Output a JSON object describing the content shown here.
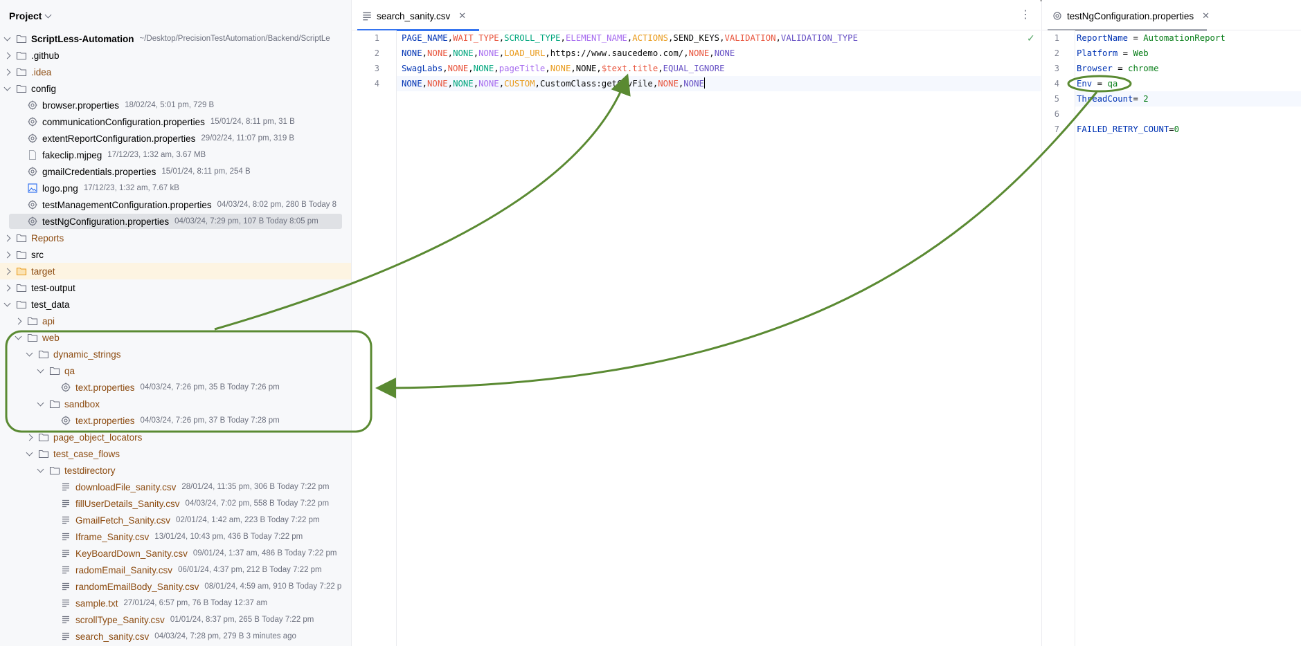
{
  "project": {
    "title": "Project",
    "tree": [
      {
        "name": "ScriptLess-Automation",
        "meta": "~/Desktop/PrecisionTestAutomation/Backend/ScriptLe",
        "depth": 0,
        "chev": "open",
        "icon": "folder",
        "bold": true
      },
      {
        "name": ".github",
        "meta": "",
        "depth": 0,
        "chev": "closed",
        "icon": "folder"
      },
      {
        "name": ".idea",
        "meta": "",
        "depth": 0,
        "chev": "closed",
        "icon": "folder",
        "brown": true
      },
      {
        "name": "config",
        "meta": "",
        "depth": 0,
        "chev": "open",
        "icon": "folder"
      },
      {
        "name": "browser.properties",
        "meta": "18/02/24, 5:01 pm, 729 B",
        "depth": 1,
        "chev": "none",
        "icon": "gear"
      },
      {
        "name": "communicationConfiguration.properties",
        "meta": "15/01/24, 8:11 pm, 31 B",
        "depth": 1,
        "chev": "none",
        "icon": "gear"
      },
      {
        "name": "extentReportConfiguration.properties",
        "meta": "29/02/24, 11:07 pm, 319 B",
        "depth": 1,
        "chev": "none",
        "icon": "gear"
      },
      {
        "name": "fakeclip.mjpeg",
        "meta": "17/12/23, 1:32 am, 3.67 MB",
        "depth": 1,
        "chev": "none",
        "icon": "file"
      },
      {
        "name": "gmailCredentials.properties",
        "meta": "15/01/24, 8:11 pm, 254 B",
        "depth": 1,
        "chev": "none",
        "icon": "gear"
      },
      {
        "name": "logo.png",
        "meta": "17/12/23, 1:32 am, 7.67 kB",
        "depth": 1,
        "chev": "none",
        "icon": "image"
      },
      {
        "name": "testManagementConfiguration.properties",
        "meta": "04/03/24, 8:02 pm, 280 B Today 8",
        "depth": 1,
        "chev": "none",
        "icon": "gear"
      },
      {
        "name": "testNgConfiguration.properties",
        "meta": "04/03/24, 7:29 pm, 107 B Today 8:05 pm",
        "depth": 1,
        "chev": "none",
        "icon": "gear",
        "selected": true
      },
      {
        "name": "Reports",
        "meta": "",
        "depth": 0,
        "chev": "closed",
        "icon": "folder",
        "brown": true
      },
      {
        "name": "src",
        "meta": "",
        "depth": 0,
        "chev": "closed",
        "icon": "folder"
      },
      {
        "name": "target",
        "meta": "",
        "depth": 0,
        "chev": "closed",
        "icon": "folder-orange",
        "brown": true,
        "highlight": true
      },
      {
        "name": "test-output",
        "meta": "",
        "depth": 0,
        "chev": "closed",
        "icon": "folder"
      },
      {
        "name": "test_data",
        "meta": "",
        "depth": 0,
        "chev": "open",
        "icon": "folder"
      },
      {
        "name": "api",
        "meta": "",
        "depth": 1,
        "chev": "closed",
        "icon": "folder",
        "brown": true
      },
      {
        "name": "web",
        "meta": "",
        "depth": 1,
        "chev": "open",
        "icon": "folder",
        "brown": true
      },
      {
        "name": "dynamic_strings",
        "meta": "",
        "depth": 2,
        "chev": "open",
        "icon": "folder",
        "brown": true
      },
      {
        "name": "qa",
        "meta": "",
        "depth": 3,
        "chev": "open",
        "icon": "folder",
        "brown": true
      },
      {
        "name": "text.properties",
        "meta": "04/03/24, 7:26 pm, 35 B Today 7:26 pm",
        "depth": 4,
        "chev": "none",
        "icon": "gear",
        "brown": true
      },
      {
        "name": "sandbox",
        "meta": "",
        "depth": 3,
        "chev": "open",
        "icon": "folder",
        "brown": true
      },
      {
        "name": "text.properties",
        "meta": "04/03/24, 7:26 pm, 37 B Today 7:28 pm",
        "depth": 4,
        "chev": "none",
        "icon": "gear",
        "brown": true
      },
      {
        "name": "page_object_locators",
        "meta": "",
        "depth": 2,
        "chev": "closed",
        "icon": "folder",
        "brown": true
      },
      {
        "name": "test_case_flows",
        "meta": "",
        "depth": 2,
        "chev": "open",
        "icon": "folder",
        "brown": true
      },
      {
        "name": "testdirectory",
        "meta": "",
        "depth": 3,
        "chev": "open",
        "icon": "folder",
        "brown": true
      },
      {
        "name": "downloadFile_sanity.csv",
        "meta": "28/01/24, 11:35 pm, 306 B Today 7:22 pm",
        "depth": 4,
        "chev": "none",
        "icon": "text",
        "brown": true
      },
      {
        "name": "fillUserDetails_Sanity.csv",
        "meta": "04/03/24, 7:02 pm, 558 B Today 7:22 pm",
        "depth": 4,
        "chev": "none",
        "icon": "text",
        "brown": true
      },
      {
        "name": "GmailFetch_Sanity.csv",
        "meta": "02/01/24, 1:42 am, 223 B Today 7:22 pm",
        "depth": 4,
        "chev": "none",
        "icon": "text",
        "brown": true
      },
      {
        "name": "Iframe_Sanity.csv",
        "meta": "13/01/24, 10:43 pm, 436 B Today 7:22 pm",
        "depth": 4,
        "chev": "none",
        "icon": "text",
        "brown": true
      },
      {
        "name": "KeyBoardDown_Sanity.csv",
        "meta": "09/01/24, 1:37 am, 486 B Today 7:22 pm",
        "depth": 4,
        "chev": "none",
        "icon": "text",
        "brown": true
      },
      {
        "name": "radomEmail_Sanity.csv",
        "meta": "06/01/24, 4:37 pm, 212 B Today 7:22 pm",
        "depth": 4,
        "chev": "none",
        "icon": "text",
        "brown": true
      },
      {
        "name": "randomEmailBody_Sanity.csv",
        "meta": "08/01/24, 4:59 am, 910 B Today 7:22 p",
        "depth": 4,
        "chev": "none",
        "icon": "text",
        "brown": true
      },
      {
        "name": "sample.txt",
        "meta": "27/01/24, 6:57 pm, 76 B Today 12:37 am",
        "depth": 4,
        "chev": "none",
        "icon": "text",
        "brown": true
      },
      {
        "name": "scrollType_Sanity.csv",
        "meta": "01/01/24, 8:37 pm, 265 B Today 7:22 pm",
        "depth": 4,
        "chev": "none",
        "icon": "text",
        "brown": true
      },
      {
        "name": "search_sanity.csv",
        "meta": "04/03/24, 7:28 pm, 279 B 3 minutes ago",
        "depth": 4,
        "chev": "none",
        "icon": "text",
        "brown": true
      }
    ]
  },
  "editor_left": {
    "tab_label": "search_sanity.csv",
    "close_glyph": "✕",
    "more_glyph": "⋮",
    "check_glyph": "✓",
    "line_numbers": [
      "1",
      "2",
      "3",
      "4"
    ],
    "lines": [
      [
        {
          "t": "PAGE_NAME",
          "c": "#0033b3"
        },
        {
          "t": ",",
          "c": "#000000"
        },
        {
          "t": "WAIT_TYPE",
          "c": "#e8533b"
        },
        {
          "t": ",",
          "c": "#000000"
        },
        {
          "t": "SCROLL_TYPE",
          "c": "#00a67d"
        },
        {
          "t": ",",
          "c": "#000000"
        },
        {
          "t": "ELEMENT_NAME",
          "c": "#a66bef"
        },
        {
          "t": ",",
          "c": "#000000"
        },
        {
          "t": "ACTIONS",
          "c": "#e99a1a"
        },
        {
          "t": ",",
          "c": "#000000"
        },
        {
          "t": "SEND_KEYS",
          "c": "#0d0d0d"
        },
        {
          "t": ",",
          "c": "#000000"
        },
        {
          "t": "VALIDATION",
          "c": "#e8533b"
        },
        {
          "t": ",",
          "c": "#000000"
        },
        {
          "t": "VALIDATION_TYPE",
          "c": "#6650c4"
        }
      ],
      [
        {
          "t": "NONE",
          "c": "#0033b3"
        },
        {
          "t": ",",
          "c": "#000000"
        },
        {
          "t": "NONE",
          "c": "#e8533b"
        },
        {
          "t": ",",
          "c": "#000000"
        },
        {
          "t": "NONE",
          "c": "#00a67d"
        },
        {
          "t": ",",
          "c": "#000000"
        },
        {
          "t": "NONE",
          "c": "#a66bef"
        },
        {
          "t": ",",
          "c": "#000000"
        },
        {
          "t": "LOAD_URL",
          "c": "#e99a1a"
        },
        {
          "t": ",",
          "c": "#000000"
        },
        {
          "t": "https://www.saucedemo.com/",
          "c": "#0d0d0d"
        },
        {
          "t": ",",
          "c": "#000000"
        },
        {
          "t": "NONE",
          "c": "#e8533b"
        },
        {
          "t": ",",
          "c": "#000000"
        },
        {
          "t": "NONE",
          "c": "#6650c4"
        }
      ],
      [
        {
          "t": "SwagLabs",
          "c": "#0033b3"
        },
        {
          "t": ",",
          "c": "#000000"
        },
        {
          "t": "NONE",
          "c": "#e8533b"
        },
        {
          "t": ",",
          "c": "#000000"
        },
        {
          "t": "NONE",
          "c": "#00a67d"
        },
        {
          "t": ",",
          "c": "#000000"
        },
        {
          "t": "pageTitle",
          "c": "#a66bef"
        },
        {
          "t": ",",
          "c": "#000000"
        },
        {
          "t": "NONE",
          "c": "#e99a1a"
        },
        {
          "t": ",",
          "c": "#000000"
        },
        {
          "t": "NONE",
          "c": "#0d0d0d"
        },
        {
          "t": ",",
          "c": "#000000"
        },
        {
          "t": "$text.title",
          "c": "#e8533b"
        },
        {
          "t": ",",
          "c": "#000000"
        },
        {
          "t": "EQUAL_IGNORE",
          "c": "#6650c4"
        }
      ],
      [
        {
          "t": "NONE",
          "c": "#0033b3"
        },
        {
          "t": ",",
          "c": "#000000"
        },
        {
          "t": "NONE",
          "c": "#e8533b"
        },
        {
          "t": ",",
          "c": "#000000"
        },
        {
          "t": "NONE",
          "c": "#00a67d"
        },
        {
          "t": ",",
          "c": "#000000"
        },
        {
          "t": "NONE",
          "c": "#a66bef"
        },
        {
          "t": ",",
          "c": "#000000"
        },
        {
          "t": "CUSTOM",
          "c": "#e99a1a"
        },
        {
          "t": ",",
          "c": "#000000"
        },
        {
          "t": "CustomClass:getCsvFile",
          "c": "#0d0d0d"
        },
        {
          "t": ",",
          "c": "#000000"
        },
        {
          "t": "NONE",
          "c": "#e8533b"
        },
        {
          "t": ",",
          "c": "#000000"
        },
        {
          "t": "NONE",
          "c": "#6650c4"
        }
      ]
    ]
  },
  "editor_right": {
    "tab_label": "testNgConfiguration.properties",
    "close_glyph": "✕",
    "line_numbers": [
      "1",
      "2",
      "3",
      "4",
      "5",
      "6",
      "7"
    ],
    "lines": [
      {
        "key": "ReportName",
        "sep": " = ",
        "val": "AutomationReport"
      },
      {
        "key": "Platform",
        "sep": " = ",
        "val": "Web"
      },
      {
        "key": "Browser",
        "sep": " = ",
        "val": "chrome"
      },
      {
        "key": "Env",
        "sep": " = ",
        "val": "qa"
      },
      {
        "key": "ThreadCount",
        "sep": "= ",
        "val": "2"
      },
      {
        "key": "",
        "sep": "",
        "val": ""
      },
      {
        "key": "FAILED_RETRY_COUNT",
        "sep": "=",
        "val": "0"
      }
    ]
  },
  "colors": {
    "annotation_green": "#5a8a32",
    "tab_accent": "#3574f0",
    "folder_icon": "#6c707e",
    "folder_orange": "#e99a1a"
  }
}
